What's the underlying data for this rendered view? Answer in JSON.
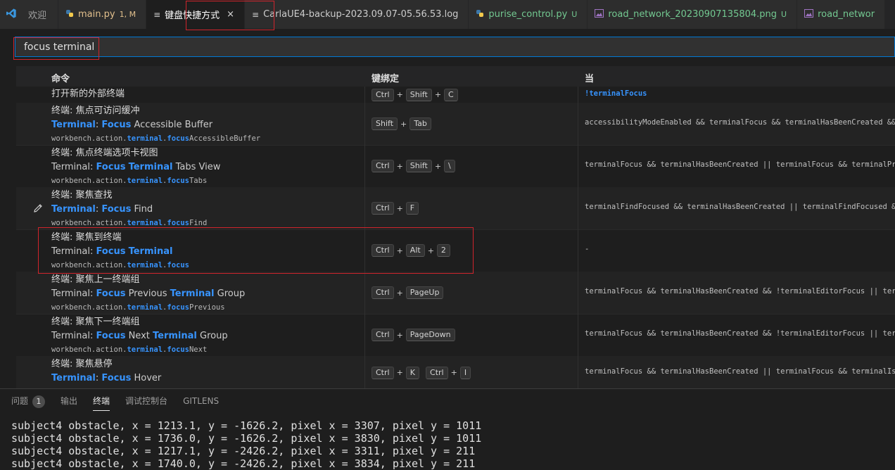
{
  "tabs": [
    {
      "icon": "vscode-logo-icon",
      "label": "欢迎",
      "badge": "",
      "active": false,
      "label_color": "#a0a0a0"
    },
    {
      "icon": "python-file-icon",
      "label": "main.py",
      "badge": "1, M",
      "active": false,
      "label_color": "#e2c08d"
    },
    {
      "icon": "keybindings-file-icon",
      "label": "键盘快捷方式",
      "badge": "",
      "active": true,
      "close": "×",
      "label_color": "#ffffff"
    },
    {
      "icon": "log-file-icon",
      "label": "CarlaUE4-backup-2023.09.07-05.56.53.log",
      "badge": "",
      "active": false,
      "label_color": "#cccccc"
    },
    {
      "icon": "python-file-icon",
      "label": "purise_control.py",
      "badge": "U",
      "active": false,
      "label_color": "#73c991"
    },
    {
      "icon": "image-file-icon",
      "label": "road_network_20230907135804.png",
      "badge": "U",
      "active": false,
      "label_color": "#73c991"
    },
    {
      "icon": "image-file-icon",
      "label": "road_networ",
      "badge": "",
      "active": false,
      "label_color": "#73c991"
    }
  ],
  "search": {
    "value": "focus terminal"
  },
  "table": {
    "headers": {
      "command": "命令",
      "keybinding": "键绑定",
      "when": "当"
    },
    "rows": [
      {
        "title": "打开新的外部终端",
        "subtitle": [],
        "id": [],
        "keys": [
          [
            "Ctrl",
            "Shift",
            "C"
          ]
        ],
        "when": "!terminalFocus",
        "when_highlight": true,
        "edit": false
      },
      {
        "title": "终端: 焦点可访问缓冲",
        "subtitle": [
          [
            "Terminal",
            true
          ],
          [
            ": ",
            false
          ],
          [
            "Focus",
            true
          ],
          [
            " Accessible Buffer",
            false
          ]
        ],
        "id": [
          [
            "workbench.action.",
            false
          ],
          [
            "terminal",
            true
          ],
          [
            ".",
            false
          ],
          [
            "focus",
            true
          ],
          [
            "AccessibleBuffer",
            false
          ]
        ],
        "keys": [
          [
            "Shift",
            "Tab"
          ]
        ],
        "when": "accessibilityModeEnabled && terminalFocus && terminalHasBeenCreated && termi",
        "when_highlight": false,
        "edit": false
      },
      {
        "title": "终端: 焦点终端选项卡视图",
        "subtitle": [
          [
            "Terminal: ",
            false
          ],
          [
            "Focus",
            true
          ],
          [
            " ",
            false
          ],
          [
            "Terminal",
            true
          ],
          [
            " Tabs View",
            false
          ]
        ],
        "id": [
          [
            "workbench.action.",
            false
          ],
          [
            "terminal",
            true
          ],
          [
            ".",
            false
          ],
          [
            "focus",
            true
          ],
          [
            "Tabs",
            false
          ]
        ],
        "keys": [
          [
            "Ctrl",
            "Shift",
            "\\"
          ]
        ],
        "when": "terminalFocus && terminalHasBeenCreated || terminalFocus && terminalProcessS",
        "when_highlight": false,
        "edit": false
      },
      {
        "title": "终端: 聚焦查找",
        "subtitle": [
          [
            "Terminal",
            true
          ],
          [
            ": ",
            false
          ],
          [
            "Focus",
            true
          ],
          [
            " Find",
            false
          ]
        ],
        "id": [
          [
            "workbench.action.",
            false
          ],
          [
            "terminal",
            true
          ],
          [
            ".",
            false
          ],
          [
            "focus",
            true
          ],
          [
            "Find",
            false
          ]
        ],
        "keys": [
          [
            "Ctrl",
            "F"
          ]
        ],
        "when": "terminalFindFocused && terminalHasBeenCreated || terminalFindFocused && term",
        "when_highlight": false,
        "edit": true
      },
      {
        "title": "终端: 聚焦到终端",
        "subtitle": [
          [
            "Terminal: ",
            false
          ],
          [
            "Focus",
            true
          ],
          [
            " ",
            false
          ],
          [
            "Terminal",
            true
          ]
        ],
        "id": [
          [
            "workbench.action.",
            false
          ],
          [
            "terminal",
            true
          ],
          [
            ".",
            false
          ],
          [
            "focus",
            true
          ]
        ],
        "keys": [
          [
            "Ctrl",
            "Alt",
            "2"
          ]
        ],
        "when": "-",
        "when_highlight": false,
        "edit": false
      },
      {
        "title": "终端: 聚焦上一终端组",
        "subtitle": [
          [
            "Terminal: ",
            false
          ],
          [
            "Focus",
            true
          ],
          [
            " Previous ",
            false
          ],
          [
            "Terminal",
            true
          ],
          [
            " Group",
            false
          ]
        ],
        "id": [
          [
            "workbench.action.",
            false
          ],
          [
            "terminal",
            true
          ],
          [
            ".",
            false
          ],
          [
            "focus",
            true
          ],
          [
            "Previous",
            false
          ]
        ],
        "keys": [
          [
            "Ctrl",
            "PageUp"
          ]
        ],
        "when": "terminalFocus && terminalHasBeenCreated && !terminalEditorFocus || terminalP",
        "when_highlight": false,
        "edit": false
      },
      {
        "title": "终端: 聚焦下一终端组",
        "subtitle": [
          [
            "Terminal: ",
            false
          ],
          [
            "Focus",
            true
          ],
          [
            " Next ",
            false
          ],
          [
            "Terminal",
            true
          ],
          [
            " Group",
            false
          ]
        ],
        "id": [
          [
            "workbench.action.",
            false
          ],
          [
            "terminal",
            true
          ],
          [
            ".",
            false
          ],
          [
            "focus",
            true
          ],
          [
            "Next",
            false
          ]
        ],
        "keys": [
          [
            "Ctrl",
            "PageDown"
          ]
        ],
        "when": "terminalFocus && terminalHasBeenCreated && !terminalEditorFocus || terminalP",
        "when_highlight": false,
        "edit": false
      },
      {
        "title": "终端: 聚焦悬停",
        "subtitle": [
          [
            "Terminal",
            true
          ],
          [
            ": ",
            false
          ],
          [
            "Focus",
            true
          ],
          [
            " Hover",
            false
          ]
        ],
        "id": [],
        "keys": [
          [
            "Ctrl",
            "K"
          ],
          [
            "Ctrl",
            "I"
          ]
        ],
        "when": "terminalFocus && terminalHasBeenCreated || terminalFocus && terminalIsOpen",
        "when_highlight": false,
        "edit": false
      }
    ]
  },
  "panel": {
    "tabs": [
      {
        "label": "问题",
        "badge": "1",
        "active": false
      },
      {
        "label": "输出",
        "badge": "",
        "active": false
      },
      {
        "label": "终端",
        "badge": "",
        "active": true
      },
      {
        "label": "调试控制台",
        "badge": "",
        "active": false
      },
      {
        "label": "GITLENS",
        "badge": "",
        "active": false
      }
    ],
    "terminal_lines": [
      "subject4 obstacle, x = 1213.1, y = -1626.2, pixel x = 3307, pixel y = 1011",
      "subject4 obstacle, x = 1736.0, y = -1626.2, pixel x = 3830, pixel y = 1011",
      "subject4 obstacle, x = 1217.1, y = -2426.2, pixel x = 3311, pixel y = 211",
      "subject4 obstacle, x = 1740.0, y = -2426.2, pixel x = 3834, pixel y = 211"
    ]
  },
  "colors": {
    "accent": "#3794ff",
    "highlight_box": "#d0242c",
    "focus_border": "#0078d4",
    "modified": "#e2c08d",
    "untracked": "#73c991"
  }
}
